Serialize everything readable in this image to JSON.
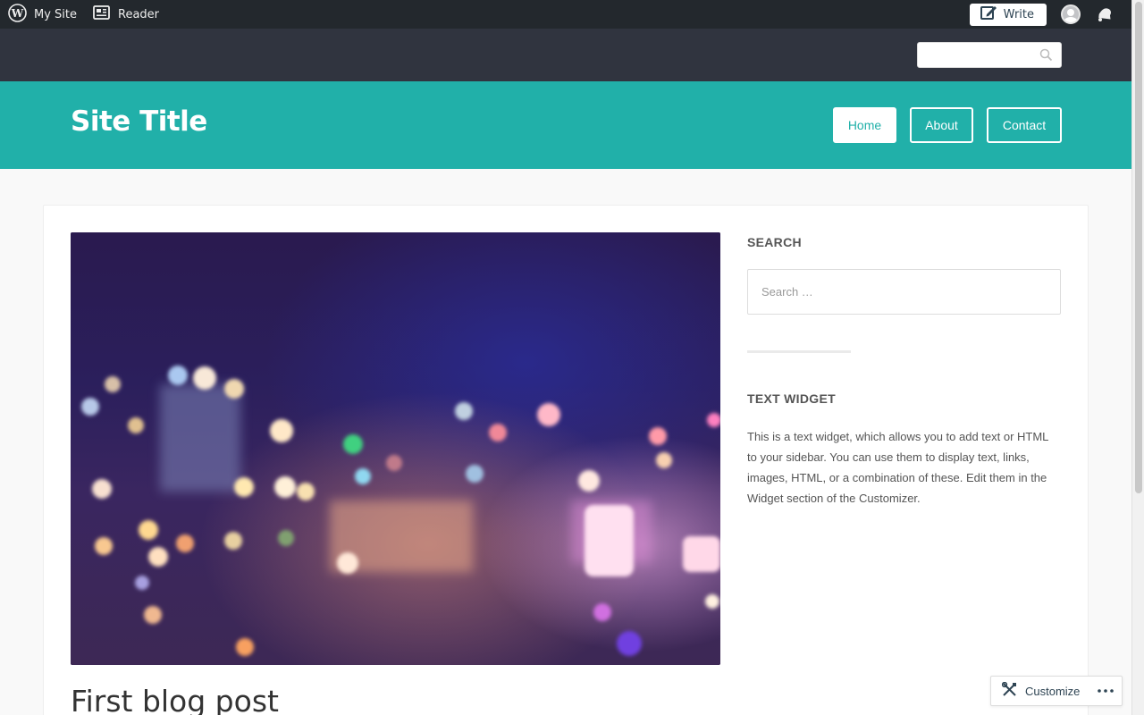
{
  "adminbar": {
    "my_site": "My Site",
    "reader": "Reader",
    "write": "Write"
  },
  "header": {
    "site_title": "Site Title",
    "nav": [
      {
        "label": "Home",
        "active": true
      },
      {
        "label": "About",
        "active": false
      },
      {
        "label": "Contact",
        "active": false
      }
    ],
    "accent": "#21b0a9"
  },
  "sidebar": {
    "search_title": "SEARCH",
    "search_placeholder": "Search …",
    "text_title": "TEXT WIDGET",
    "text_body": "This is a text widget, which allows you to add text or HTML to your sidebar. You can use them to display text, links, images, HTML, or a combination of these. Edit them in the Widget section of the Customizer."
  },
  "post": {
    "title": "First blog post"
  },
  "customize": {
    "label": "Customize"
  }
}
